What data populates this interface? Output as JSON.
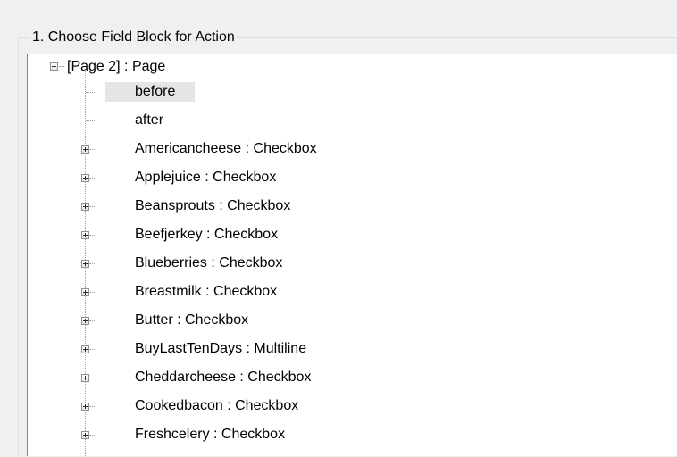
{
  "groupbox": {
    "title": "1. Choose Field Block for Action"
  },
  "tree": {
    "root": {
      "label": "[Page 2] : Page",
      "expanded": true,
      "children": [
        {
          "label": "before",
          "expandable": false,
          "selected": true,
          "name": "tree-node-before"
        },
        {
          "label": "after",
          "expandable": false,
          "selected": false,
          "name": "tree-node-after"
        },
        {
          "label": "Americancheese : Checkbox",
          "expandable": true,
          "name": "tree-node-americancheese"
        },
        {
          "label": "Applejuice : Checkbox",
          "expandable": true,
          "name": "tree-node-applejuice"
        },
        {
          "label": "Beansprouts : Checkbox",
          "expandable": true,
          "name": "tree-node-beansprouts"
        },
        {
          "label": "Beefjerkey : Checkbox",
          "expandable": true,
          "name": "tree-node-beefjerkey"
        },
        {
          "label": "Blueberries : Checkbox",
          "expandable": true,
          "name": "tree-node-blueberries"
        },
        {
          "label": "Breastmilk : Checkbox",
          "expandable": true,
          "name": "tree-node-breastmilk"
        },
        {
          "label": "Butter : Checkbox",
          "expandable": true,
          "name": "tree-node-butter"
        },
        {
          "label": "BuyLastTenDays : Multiline",
          "expandable": true,
          "name": "tree-node-buylasttendays"
        },
        {
          "label": "Cheddarcheese : Checkbox",
          "expandable": true,
          "name": "tree-node-cheddarcheese"
        },
        {
          "label": "Cookedbacon : Checkbox",
          "expandable": true,
          "name": "tree-node-cookedbacon"
        },
        {
          "label": "Freshcelery : Checkbox",
          "expandable": true,
          "name": "tree-node-freshcelery"
        }
      ]
    }
  }
}
